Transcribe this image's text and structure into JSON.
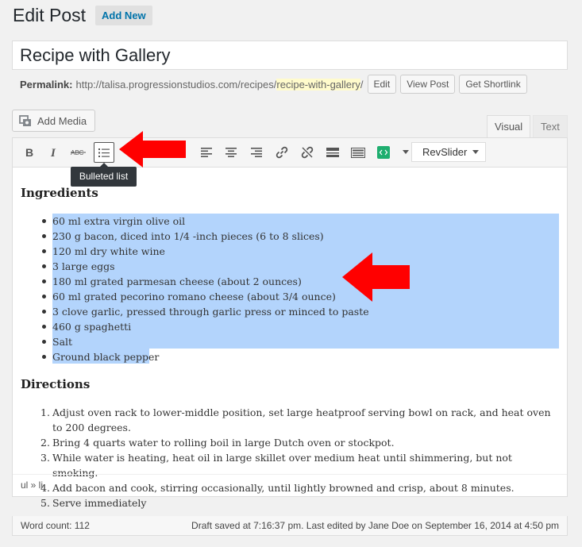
{
  "header": {
    "title": "Edit Post",
    "add_new": "Add New"
  },
  "post": {
    "title": "Recipe with Gallery"
  },
  "permalink": {
    "label": "Permalink:",
    "base": "http://talisa.progressionstudios.com/recipes/",
    "slug": "recipe-with-gallery",
    "trailing": "/",
    "buttons": {
      "edit": "Edit",
      "view": "View Post",
      "shortlink": "Get Shortlink"
    }
  },
  "media": {
    "add_media": "Add Media"
  },
  "tabs": {
    "visual": "Visual",
    "text": "Text"
  },
  "toolbar": {
    "tooltip": "Bulleted list",
    "revslider": "RevSlider",
    "icons": [
      "bold-icon",
      "italic-icon",
      "strikethrough-icon",
      "bulleted-list-icon",
      "align-left-icon",
      "align-center-icon",
      "align-right-icon",
      "link-icon",
      "unlink-icon",
      "read-more-icon",
      "toolbar-toggle-icon",
      "shortcode-icon"
    ]
  },
  "content": {
    "ingredients_heading": "Ingredients",
    "ingredients": [
      "60 ml extra virgin olive oil",
      "230 g bacon, diced into 1/4 -inch pieces (6 to 8 slices)",
      "120 ml dry white wine",
      "3 large eggs",
      "180 ml grated parmesan cheese (about 2 ounces)",
      "60 ml grated pecorino romano cheese (about 3/4 ounce)",
      "3 clove garlic, pressed through garlic press or minced to paste",
      "460 g spaghetti",
      "Salt",
      "Ground black pepper"
    ],
    "directions_heading": "Directions",
    "directions": [
      {
        "num": "1.",
        "text": "Adjust oven rack to lower-middle position, set large heatproof serving bowl on rack, and heat oven to 200 degrees."
      },
      {
        "num": "2.",
        "text": "Bring 4 quarts water to rolling boil in large Dutch oven or stockpot."
      },
      {
        "num": "3.",
        "text": "While water is heating, heat oil in large skillet over medium heat until shimmering, but not smoking."
      },
      {
        "num": "4.",
        "text": "Add bacon and cook, stirring occasionally, until lightly browned and crisp, about 8 minutes."
      },
      {
        "num": "5.",
        "text": "Serve immediately"
      }
    ]
  },
  "path_bar": "ul » li",
  "status": {
    "word_count": "Word count: 112",
    "draft": "Draft saved at 7:16:37 pm. Last edited by Jane Doe on September 16, 2014 at 4:50 pm"
  },
  "colors": {
    "link": "#0073aa",
    "selection": "#b3d4fc",
    "arrow": "#ff0000",
    "slug_highlight": "#fffbcc"
  }
}
